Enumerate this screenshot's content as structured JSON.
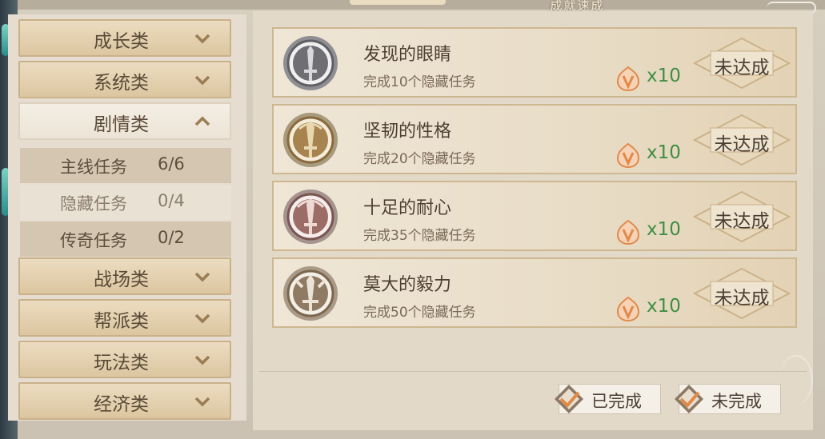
{
  "title": "成就速成",
  "sidebar": {
    "categories_top": [
      {
        "label": "成长类",
        "open": false
      },
      {
        "label": "系统类",
        "open": false
      },
      {
        "label": "剧情类",
        "open": true
      }
    ],
    "subitems": [
      {
        "name": "主线任务",
        "progress": "6/6",
        "style": "dark"
      },
      {
        "name": "隐藏任务",
        "progress": "0/4",
        "style": "light"
      },
      {
        "name": "传奇任务",
        "progress": "0/2",
        "style": "dark"
      }
    ],
    "categories_bottom": [
      {
        "label": "战场类"
      },
      {
        "label": "帮派类"
      },
      {
        "label": "玩法类"
      },
      {
        "label": "经济类"
      }
    ]
  },
  "achievements": [
    {
      "name": "发现的眼睛",
      "desc": "完成10个隐藏任务",
      "reward": "x10",
      "status": "未达成",
      "medal": "silver"
    },
    {
      "name": "坚韧的性格",
      "desc": "完成20个隐藏任务",
      "reward": "x10",
      "status": "未达成",
      "medal": "gold"
    },
    {
      "name": "十足的耐心",
      "desc": "完成35个隐藏任务",
      "reward": "x10",
      "status": "未达成",
      "medal": "rose"
    },
    {
      "name": "莫大的毅力",
      "desc": "完成50个隐藏任务",
      "reward": "x10",
      "status": "未达成",
      "medal": "bronze"
    }
  ],
  "filters": {
    "completed": "已完成",
    "incomplete": "未完成"
  },
  "colors": {
    "reward_green": "#3f8e42",
    "accent_orange": "#e08a4a",
    "card_border": "#cdb791"
  }
}
